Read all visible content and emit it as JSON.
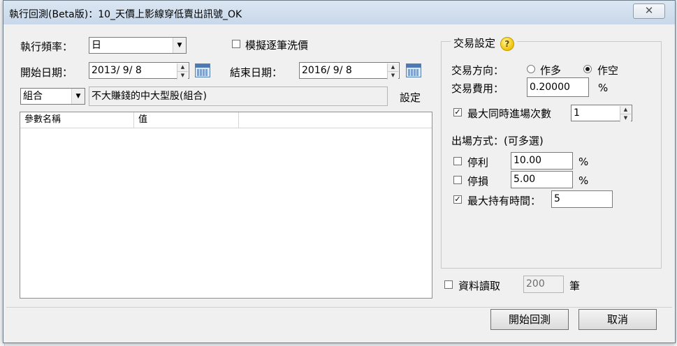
{
  "window": {
    "title": "執行回測(Beta版)：10_天價上影線穿低賣出訊號_OK",
    "close_glyph": "✕"
  },
  "left": {
    "frequency_label": "執行頻率：",
    "frequency_value": "日",
    "simulate_label": "模擬逐筆洗價",
    "start_date_label": "開始日期：",
    "start_date_value": "2013/  9/  8",
    "end_date_label": "結束日期：",
    "end_date_value": "2016/  9/  8",
    "scope_value": "組合",
    "scope_desc": "不大賺錢的中大型股(組合)",
    "settings_label": "設定",
    "grid_headers": [
      "參數名稱",
      "值"
    ]
  },
  "trade": {
    "group_title": "交易設定",
    "help_glyph": "?",
    "direction_label": "交易方向：",
    "direction_options": [
      "作多",
      "作空"
    ],
    "direction_selected": "作空",
    "fee_label": "交易費用：",
    "fee_value": "0.20000",
    "fee_unit": "%",
    "max_entries_label": "最大同時進場次數",
    "max_entries_checked": true,
    "max_entries_value": "1",
    "exit_label": "出場方式：(可多選)",
    "take_profit_label": "停利",
    "take_profit_value": "10.00",
    "take_profit_unit": "%",
    "stop_loss_label": "停損",
    "stop_loss_value": "5.00",
    "stop_loss_unit": "%",
    "max_hold_label": "最大持有時間：",
    "max_hold_checked": true,
    "max_hold_value": "5",
    "data_read_label": "資料讀取",
    "data_read_value": "200",
    "data_read_unit": "筆"
  },
  "buttons": {
    "start": "開始回測",
    "cancel": "取消"
  },
  "icons": {
    "checkmark": "✓",
    "combo_arrow": "▼",
    "spin_up": "▲",
    "spin_down": "▼"
  }
}
